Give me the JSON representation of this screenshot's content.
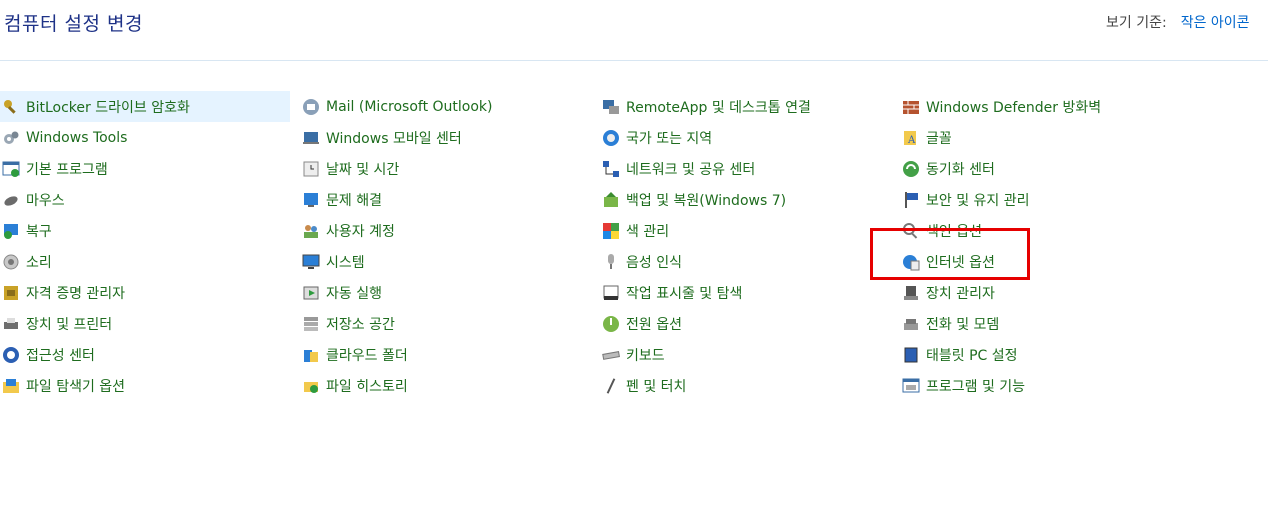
{
  "header": {
    "title": "컴퓨터 설정 변경",
    "view_by_label": "보기 기준:",
    "view_by_value": "작은 아이콘"
  },
  "columns": [
    {
      "items": [
        {
          "label": "BitLocker 드라이브 암호화",
          "icon": "bitlocker-key-icon",
          "selected": true
        },
        {
          "label": "Windows Tools",
          "icon": "gears-icon"
        },
        {
          "label": "기본 프로그램",
          "icon": "default-programs-icon"
        },
        {
          "label": "마우스",
          "icon": "mouse-icon"
        },
        {
          "label": "복구",
          "icon": "recovery-icon"
        },
        {
          "label": "소리",
          "icon": "speaker-icon"
        },
        {
          "label": "자격 증명 관리자",
          "icon": "credential-vault-icon"
        },
        {
          "label": "장치 및 프린터",
          "icon": "printer-icon"
        },
        {
          "label": "접근성 센터",
          "icon": "accessibility-icon"
        },
        {
          "label": "파일 탐색기 옵션",
          "icon": "folder-options-icon"
        }
      ]
    },
    {
      "items": [
        {
          "label": "Mail (Microsoft Outlook)",
          "icon": "mail-icon"
        },
        {
          "label": "Windows 모바일 센터",
          "icon": "mobility-center-icon"
        },
        {
          "label": "날짜 및 시간",
          "icon": "clock-icon"
        },
        {
          "label": "문제 해결",
          "icon": "troubleshoot-icon"
        },
        {
          "label": "사용자 계정",
          "icon": "users-icon"
        },
        {
          "label": "시스템",
          "icon": "monitor-icon"
        },
        {
          "label": "자동 실행",
          "icon": "autoplay-icon"
        },
        {
          "label": "저장소 공간",
          "icon": "storage-icon"
        },
        {
          "label": "클라우드 폴더",
          "icon": "cloud-folder-icon"
        },
        {
          "label": "파일 히스토리",
          "icon": "file-history-icon"
        }
      ]
    },
    {
      "items": [
        {
          "label": "RemoteApp 및 데스크톱 연결",
          "icon": "remoteapp-icon"
        },
        {
          "label": "국가 또는 지역",
          "icon": "globe-clock-icon"
        },
        {
          "label": "네트워크 및 공유 센터",
          "icon": "network-icon"
        },
        {
          "label": "백업 및 복원(Windows 7)",
          "icon": "backup-icon"
        },
        {
          "label": "색 관리",
          "icon": "color-management-icon"
        },
        {
          "label": "음성 인식",
          "icon": "microphone-icon"
        },
        {
          "label": "작업 표시줄 및 탐색",
          "icon": "taskbar-icon"
        },
        {
          "label": "전원 옵션",
          "icon": "power-icon"
        },
        {
          "label": "키보드",
          "icon": "keyboard-icon"
        },
        {
          "label": "펜 및 터치",
          "icon": "pen-icon"
        }
      ]
    },
    {
      "items": [
        {
          "label": "Windows Defender 방화벽",
          "icon": "firewall-icon"
        },
        {
          "label": "글꼴",
          "icon": "fonts-icon"
        },
        {
          "label": "동기화 센터",
          "icon": "sync-icon"
        },
        {
          "label": "보안 및 유지 관리",
          "icon": "flag-icon"
        },
        {
          "label": "색인 옵션",
          "icon": "indexing-icon"
        },
        {
          "label": "인터넷 옵션",
          "icon": "internet-options-icon"
        },
        {
          "label": "장치 관리자",
          "icon": "device-manager-icon"
        },
        {
          "label": "전화 및 모뎀",
          "icon": "phone-modem-icon"
        },
        {
          "label": "태블릿 PC 설정",
          "icon": "tablet-icon"
        },
        {
          "label": "프로그램 및 기능",
          "icon": "programs-icon"
        }
      ]
    }
  ],
  "colors": {
    "title": "#1e3287",
    "link": "#1e6c1e",
    "view_value": "#0066cc",
    "highlight": "#e60000",
    "selected_bg": "#e5f3ff"
  }
}
